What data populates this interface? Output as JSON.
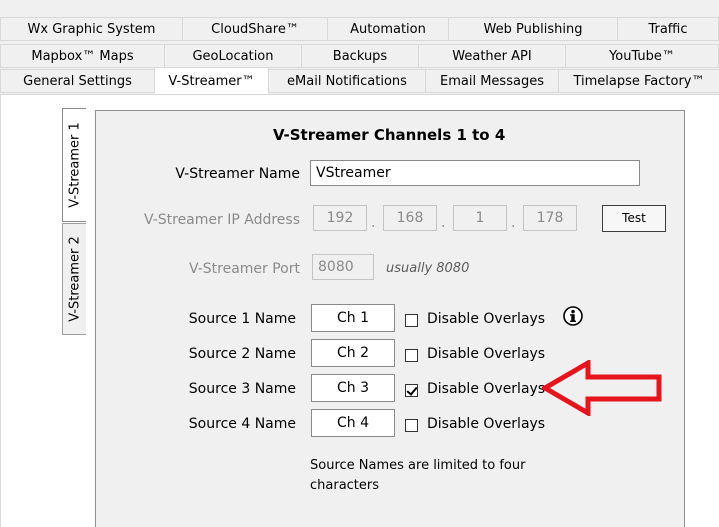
{
  "tabs": {
    "row1": [
      "Wx Graphic System",
      "CloudShare™",
      "Automation",
      "Web Publishing",
      "Traffic"
    ],
    "row2": [
      "Mapbox™ Maps",
      "GeoLocation",
      "Backups",
      "Weather API",
      "YouTube™"
    ],
    "row3": [
      "General Settings",
      "V-Streamer™",
      "eMail Notifications",
      "Email Messages",
      "Timelapse Factory™"
    ],
    "active": "V-Streamer™"
  },
  "side_tabs": [
    "V-Streamer 1",
    "V-Streamer 2"
  ],
  "panel": {
    "title": "V-Streamer Channels 1 to 4",
    "name_label": "V-Streamer Name",
    "name_value": "VStreamer",
    "ip_label": "V-Streamer IP Address",
    "ip_octets": [
      "192",
      "168",
      "1",
      "178"
    ],
    "ip_sep": ".",
    "test_label": "Test",
    "port_label": "V-Streamer Port",
    "port_value": "8080",
    "port_hint": "usually 8080",
    "sources": [
      {
        "label": "Source 1 Name",
        "value": "Ch 1",
        "disable_label": "Disable Overlays",
        "checked": false
      },
      {
        "label": "Source 2 Name",
        "value": "Ch 2",
        "disable_label": "Disable Overlays",
        "checked": false
      },
      {
        "label": "Source 3 Name",
        "value": "Ch 3",
        "disable_label": "Disable Overlays",
        "checked": true
      },
      {
        "label": "Source 4 Name",
        "value": "Ch 4",
        "disable_label": "Disable Overlays",
        "checked": false
      }
    ],
    "note": "Source Names are limited to four characters",
    "info_icon": "info-icon",
    "arrow_color": "#e8141c"
  }
}
